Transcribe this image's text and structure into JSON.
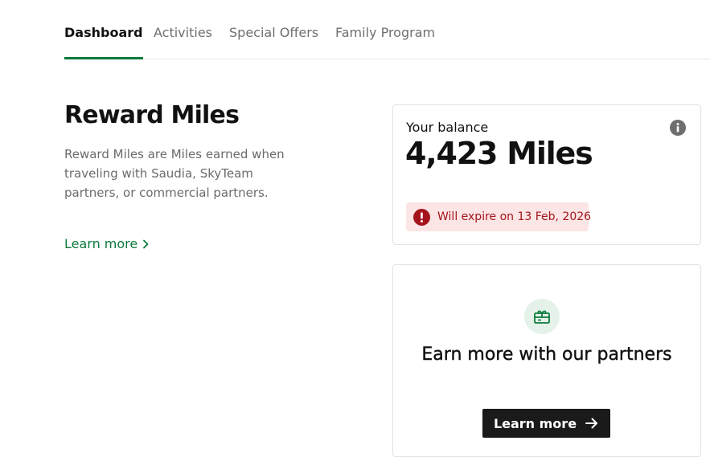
{
  "tabs": [
    {
      "label": "Dashboard",
      "active": true
    },
    {
      "label": "Activities",
      "active": false
    },
    {
      "label": "Special Offers",
      "active": false
    },
    {
      "label": "Family Program",
      "active": false
    }
  ],
  "intro": {
    "title": "Reward Miles",
    "description": "Reward Miles are Miles earned when traveling with Saudia, SkyTeam partners, or commercial partners.",
    "link_label": "Learn more",
    "link_icon": "chevron-right-icon"
  },
  "balance": {
    "label": "Your balance",
    "value": "4,423 Miles",
    "info_icon": "info-icon",
    "expiry_icon": "alert-icon",
    "expiry_text": "Will expire on 13 Feb, 2026"
  },
  "partners": {
    "icon": "gift-card-icon",
    "title": "Earn more with our partners",
    "button_label": "Learn more",
    "button_icon": "arrow-right-icon"
  },
  "colors": {
    "brand_green": "#0b7a3c",
    "alert_red": "#a5141c",
    "alert_bg": "#fbe5e5",
    "button_dark": "#1a1a1a"
  }
}
